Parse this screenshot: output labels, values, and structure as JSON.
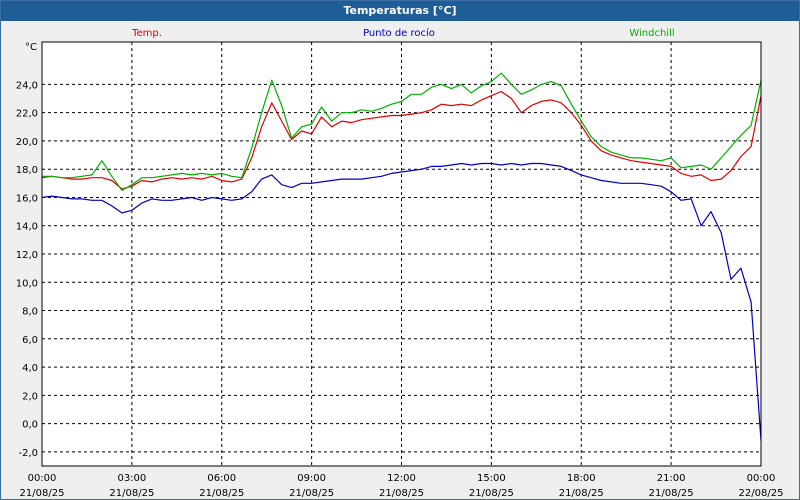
{
  "window": {
    "title": "Temperaturas [°C]"
  },
  "colors": {
    "temp": "#e00000",
    "dew": "#0000c0",
    "windchill": "#00b000",
    "background": "#ffffff",
    "grid": "#000000",
    "title_bar": "#1e5d96"
  },
  "chart_data": {
    "type": "line",
    "title": "Temperaturas [°C]",
    "ylabel": "°C",
    "xlabel": "",
    "ylim": [
      -3,
      27
    ],
    "grid": true,
    "legend_position": "top",
    "y_ticks": [
      "-2,0",
      "0,0",
      "2,0",
      "4,0",
      "6,0",
      "8,0",
      "10,0",
      "12,0",
      "14,0",
      "16,0",
      "18,0",
      "20,0",
      "22,0",
      "24,0"
    ],
    "y_tick_values": [
      -2,
      0,
      2,
      4,
      6,
      8,
      10,
      12,
      14,
      16,
      18,
      20,
      22,
      24
    ],
    "x_tick_values": [
      0,
      3,
      6,
      9,
      12,
      15,
      18,
      21,
      24
    ],
    "x_tick_times": [
      "00:00",
      "03:00",
      "06:00",
      "09:00",
      "12:00",
      "15:00",
      "18:00",
      "21:00",
      "00:00"
    ],
    "x_tick_dates": [
      "21/08/25",
      "21/08/25",
      "21/08/25",
      "21/08/25",
      "21/08/25",
      "21/08/25",
      "21/08/25",
      "21/08/25",
      "22/08/25"
    ],
    "x": [
      0,
      0.33,
      0.67,
      1,
      1.33,
      1.67,
      2,
      2.33,
      2.67,
      3,
      3.33,
      3.67,
      4,
      4.33,
      4.67,
      5,
      5.33,
      5.67,
      6,
      6.33,
      6.67,
      7,
      7.33,
      7.67,
      8,
      8.33,
      8.67,
      9,
      9.33,
      9.67,
      10,
      10.33,
      10.67,
      11,
      11.33,
      11.67,
      12,
      12.33,
      12.67,
      13,
      13.33,
      13.67,
      14,
      14.33,
      14.67,
      15,
      15.33,
      15.67,
      16,
      16.33,
      16.67,
      17,
      17.33,
      17.67,
      18,
      18.33,
      18.67,
      19,
      19.33,
      19.67,
      20,
      20.33,
      20.67,
      21,
      21.33,
      21.67,
      22,
      22.33,
      22.67,
      23,
      23.33,
      23.67,
      24
    ],
    "series": [
      {
        "name": "Temp.",
        "color": "#e00000",
        "values": [
          17.4,
          17.5,
          17.4,
          17.3,
          17.3,
          17.4,
          17.4,
          17.2,
          16.6,
          16.8,
          17.2,
          17.1,
          17.3,
          17.4,
          17.3,
          17.4,
          17.3,
          17.5,
          17.2,
          17.1,
          17.3,
          18.8,
          21.0,
          22.7,
          21.4,
          20.1,
          20.7,
          20.5,
          21.7,
          21.0,
          21.4,
          21.3,
          21.5,
          21.6,
          21.7,
          21.8,
          21.8,
          21.9,
          22.0,
          22.2,
          22.6,
          22.5,
          22.6,
          22.5,
          22.9,
          23.2,
          23.5,
          23.0,
          22.0,
          22.5,
          22.8,
          22.9,
          22.7,
          22.0,
          21.1,
          20.0,
          19.3,
          19.0,
          18.8,
          18.6,
          18.5,
          18.4,
          18.3,
          18.2,
          17.7,
          17.5,
          17.6,
          17.2,
          17.3,
          17.9,
          18.9,
          19.6,
          23.2
        ]
      },
      {
        "name": "Punto de rocío",
        "color": "#0000c0",
        "values": [
          16.0,
          16.1,
          16.0,
          15.9,
          15.9,
          15.8,
          15.8,
          15.4,
          14.9,
          15.1,
          15.6,
          15.9,
          15.8,
          15.8,
          15.9,
          16.0,
          15.8,
          16.0,
          15.9,
          15.8,
          15.9,
          16.4,
          17.3,
          17.6,
          16.9,
          16.7,
          17.0,
          17.0,
          17.1,
          17.2,
          17.3,
          17.3,
          17.3,
          17.4,
          17.5,
          17.7,
          17.8,
          17.9,
          18.0,
          18.2,
          18.2,
          18.3,
          18.4,
          18.3,
          18.4,
          18.4,
          18.3,
          18.4,
          18.3,
          18.4,
          18.4,
          18.3,
          18.2,
          17.9,
          17.6,
          17.4,
          17.2,
          17.1,
          17.0,
          17.0,
          17.0,
          16.9,
          16.8,
          16.4,
          15.8,
          15.9,
          14.0,
          15.0,
          13.5,
          10.2,
          11.0,
          8.6,
          -1.2
        ]
      },
      {
        "name": "Windchill",
        "color": "#00b000",
        "values": [
          17.5,
          17.5,
          17.4,
          17.4,
          17.5,
          17.6,
          18.6,
          17.5,
          16.5,
          16.9,
          17.4,
          17.4,
          17.5,
          17.6,
          17.7,
          17.6,
          17.7,
          17.6,
          17.7,
          17.5,
          17.4,
          19.5,
          22.0,
          24.3,
          22.5,
          20.2,
          21.0,
          21.2,
          22.4,
          21.4,
          22.0,
          22.0,
          22.2,
          22.1,
          22.3,
          22.6,
          22.8,
          23.3,
          23.3,
          23.8,
          24.0,
          23.7,
          24.0,
          23.4,
          23.9,
          24.2,
          24.8,
          24.0,
          23.3,
          23.6,
          24.0,
          24.2,
          23.9,
          22.6,
          21.4,
          20.3,
          19.6,
          19.2,
          19.0,
          18.8,
          18.8,
          18.7,
          18.6,
          18.8,
          18.1,
          18.2,
          18.3,
          18.0,
          18.8,
          19.6,
          20.4,
          21.1,
          24.3
        ]
      }
    ]
  }
}
